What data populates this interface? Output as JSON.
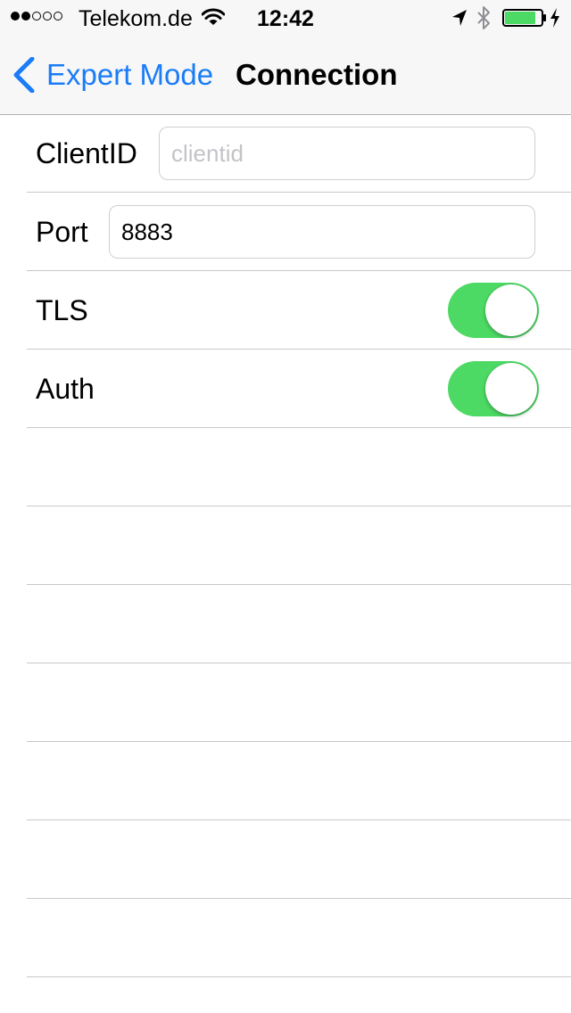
{
  "status_bar": {
    "carrier": "Telekom.de",
    "time": "12:42",
    "signal_bars_filled": 2,
    "signal_bars_total": 5,
    "icons": [
      "wifi-icon",
      "location-icon",
      "bluetooth-icon",
      "battery-icon",
      "charging-icon"
    ],
    "battery_level": 0.85
  },
  "nav": {
    "back_label": "Expert Mode",
    "title": "Connection"
  },
  "form": {
    "client_id": {
      "label": "ClientID",
      "placeholder": "clientid",
      "value": ""
    },
    "port": {
      "label": "Port",
      "value": "8883"
    },
    "tls": {
      "label": "TLS",
      "on": true
    },
    "auth": {
      "label": "Auth",
      "on": true
    }
  },
  "colors": {
    "accent": "#1a7cf6",
    "toggle_on": "#4cd964",
    "separator": "#c8c7cc",
    "nav_background": "#f7f7f8"
  }
}
